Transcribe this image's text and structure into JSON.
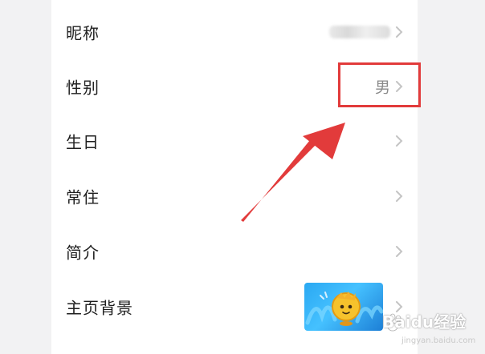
{
  "settings": {
    "rows": [
      {
        "label": "昵称"
      },
      {
        "label": "性别",
        "value": "男"
      },
      {
        "label": "生日"
      },
      {
        "label": "常住"
      },
      {
        "label": "简介"
      },
      {
        "label": "主页背景"
      }
    ]
  },
  "watermark": {
    "brand": "Baidu经验",
    "site": "jingyan.baidu.com"
  },
  "colors": {
    "annotation": "#e23b3b",
    "label": "#1f1f1f",
    "value": "#8a8a8a",
    "chevron": "#c4c4c4"
  },
  "icons": {
    "row_chevron": "chevron-right-icon",
    "thumbnail": "cartoon-balloon-character-image"
  }
}
